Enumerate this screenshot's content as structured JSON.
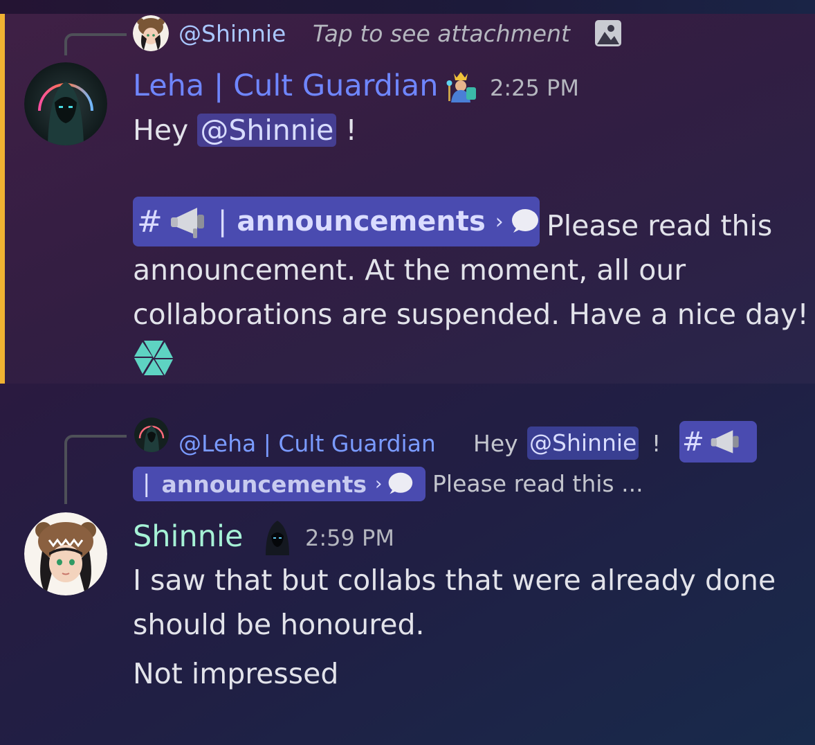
{
  "colors": {
    "mention_bar": "#f0b232",
    "username_leha": "#6f86ff",
    "username_shinnie": "#a6f2d6",
    "channel_pill": "#4a4bb0",
    "mention_bg": "#5865f2"
  },
  "message1": {
    "reply": {
      "author": "@Shinnie",
      "preview": "Tap to see attachment",
      "attachment_icon": "image-icon"
    },
    "author": "Leha | Cult Guardian",
    "timestamp": "2:25 PM",
    "greeting_prefix": "Hey",
    "mention": "@Shinnie",
    "greeting_suffix": "!",
    "channel": {
      "hash": "#",
      "icon": "megaphone-icon",
      "separator": "|",
      "name": "announcements",
      "chevron": "›",
      "thread_icon": "speech-bubble-icon"
    },
    "line1_tail": "Please read this",
    "line2": "announcement. At the moment, all our",
    "line3": "collaborations are suspended. Have a nice day!",
    "emoji": "hexagon-logo-icon"
  },
  "message2": {
    "reply": {
      "author": "@Leha | Cult Guardian",
      "preview_prefix": "Hey",
      "mention": "@Shinnie",
      "preview_suffix": "!",
      "channel_hash": "#",
      "channel_separator": "|",
      "channel_name": "announcements",
      "chevron": "›",
      "preview_tail": "Please read this ..."
    },
    "author": "Shinnie",
    "timestamp": "2:59 PM",
    "line1": "I saw that but collabs that were already done",
    "line2": "should be honoured.",
    "line3": "Not impressed"
  }
}
